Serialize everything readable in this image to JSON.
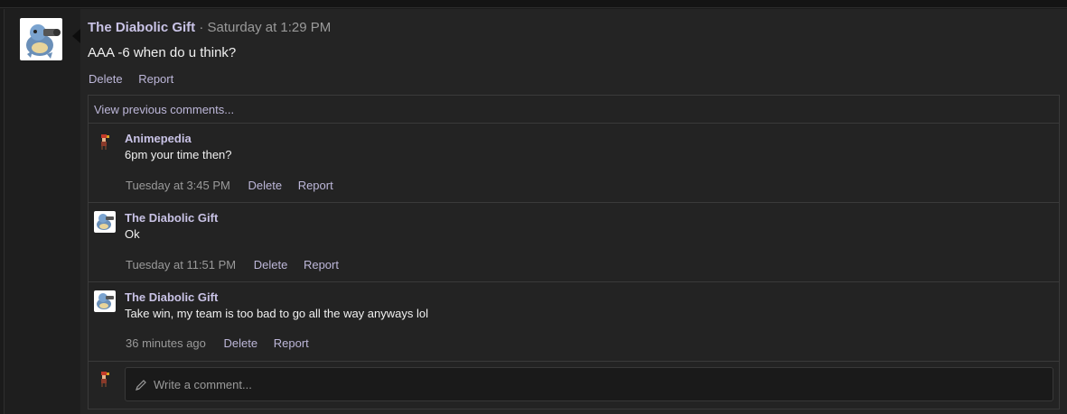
{
  "post": {
    "author": "The Diabolic Gift",
    "separator": "·",
    "time": "Saturday at 1:29 PM",
    "message": "AAA -6 when do u think?",
    "actions": {
      "delete": "Delete",
      "report": "Report"
    }
  },
  "comments": {
    "view_previous": "View previous comments...",
    "items": [
      {
        "author": "Animepedia",
        "text": "6pm your time then?",
        "time": "Tuesday at 3:45 PM",
        "delete": "Delete",
        "report": "Report"
      },
      {
        "author": "The Diabolic Gift",
        "text": "Ok",
        "time": "Tuesday at 11:51 PM",
        "delete": "Delete",
        "report": "Report"
      },
      {
        "author": "The Diabolic Gift",
        "text": "Take win, my team is too bad to go all the way anyways lol",
        "time": "36 minutes ago",
        "delete": "Delete",
        "report": "Report"
      }
    ],
    "write_placeholder": "Write a comment..."
  },
  "colors": {
    "accent": "#c9c3e6",
    "link": "#bdb7d9",
    "muted": "#9a9a9a",
    "background": "#242424"
  },
  "icons": {
    "post_avatar": "blastoise-avatar",
    "commenter_avatar": "pixel-character-avatar",
    "write": "pencil-icon"
  }
}
